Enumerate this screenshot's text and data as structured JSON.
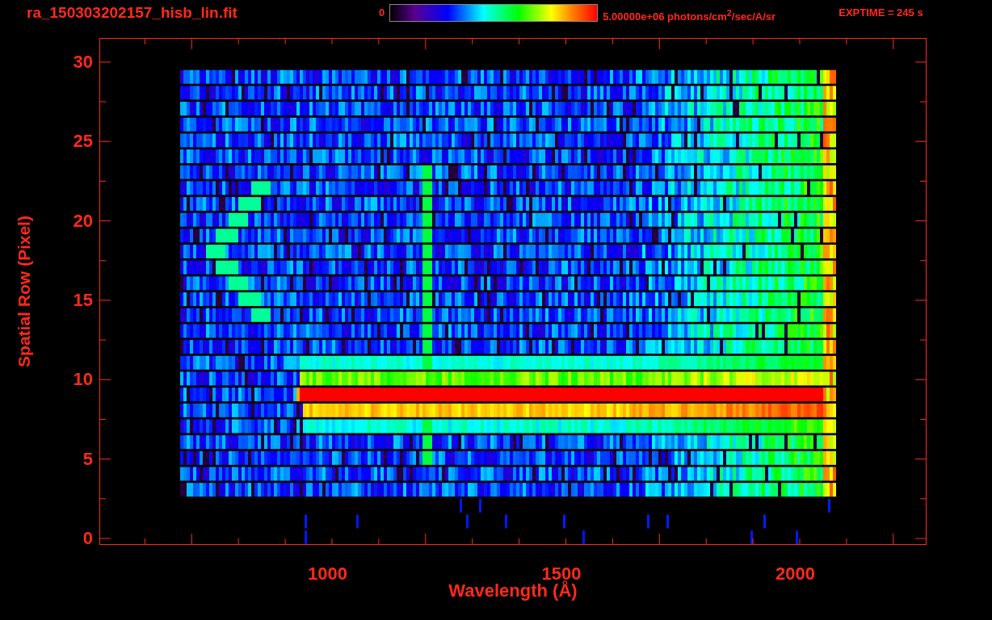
{
  "header": {
    "title": "ra_150303202157_hisb_lin.fit",
    "colorbar": {
      "min_label": "0",
      "max_label": "5.00000e+06 photons/cm$^{2}$/sec/A/sr"
    },
    "exposure": "EXPTIME = 245 s"
  },
  "y_axis": {
    "label": "Spatial Row (Pixel)",
    "ticks": [
      "30",
      "25",
      "20",
      "15",
      "10",
      "5",
      "0"
    ]
  },
  "x_axis": {
    "label": "Wavelength (Å)",
    "ticks": [
      "1000",
      "1500",
      "2000"
    ]
  }
}
